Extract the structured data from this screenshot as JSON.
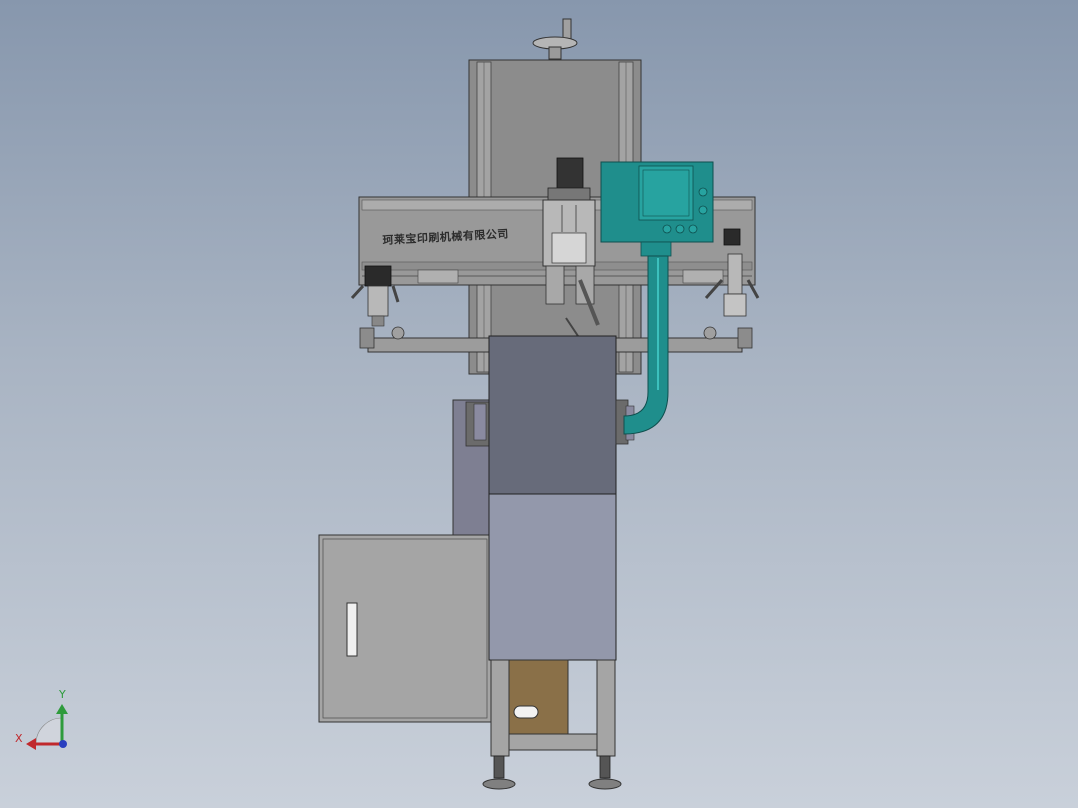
{
  "drawing": {
    "brand_text": "珂莱宝印刷机械有限公司"
  },
  "triad": {
    "x_label": "X",
    "y_label": "Y",
    "x_color": "#c0282c",
    "y_color": "#2e9b3c",
    "z_color": "#2a3fbf"
  },
  "colors": {
    "frame": "#8c8c8c",
    "steel": "#9a9a9a",
    "dark_block": "#676b7a",
    "blue_panel": "#9398ab",
    "cabinet": "#a5a5a5",
    "teal": "#1f8e8c",
    "box": "#8a7048"
  }
}
